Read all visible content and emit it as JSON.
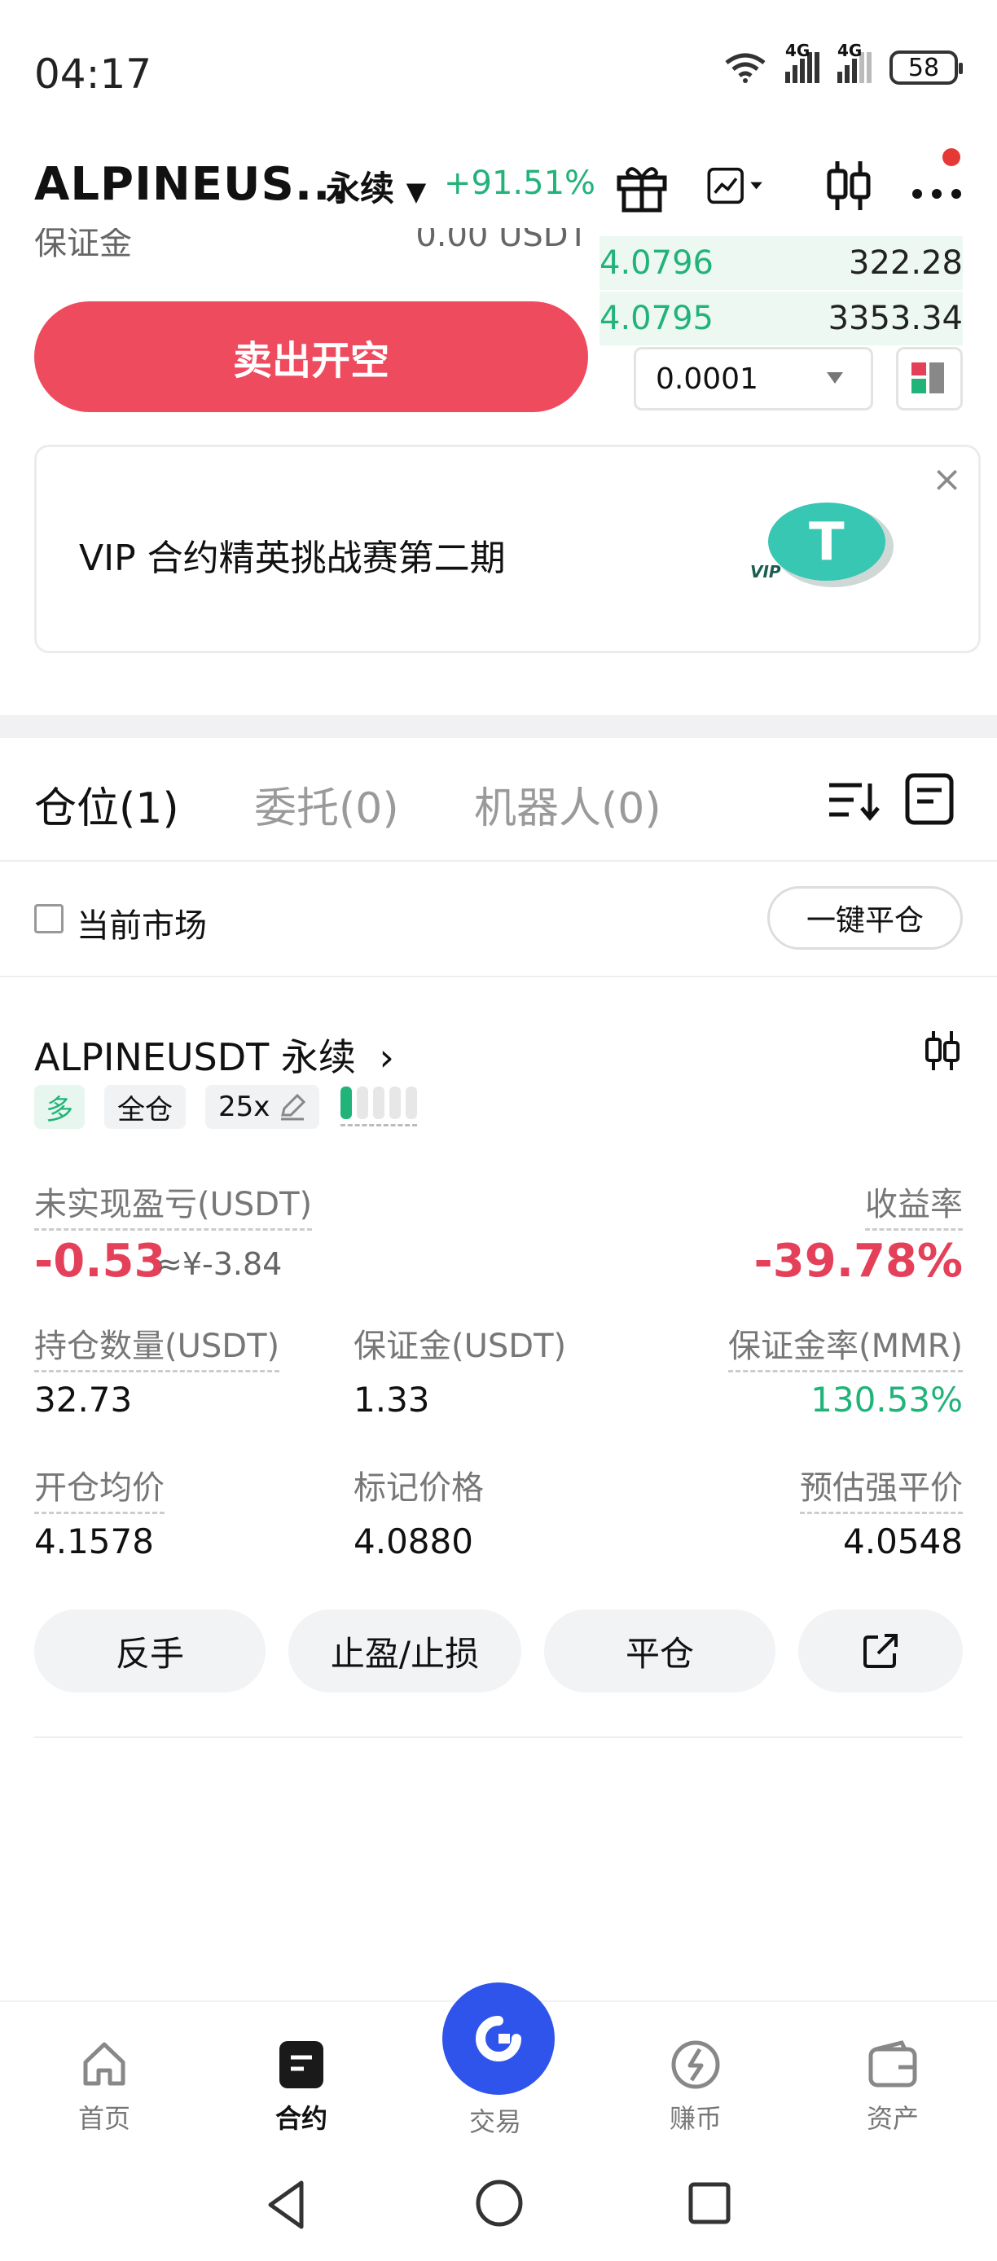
{
  "status_bar": {
    "time": "04:17",
    "network_1": "4G",
    "network_2": "4G",
    "battery": "58"
  },
  "header": {
    "pair": "ALPINEUS...",
    "contract_type": "永续",
    "change": "+91.51%"
  },
  "clipped_row": {
    "label": "保证金",
    "value": "0.00 USDT"
  },
  "order_book": [
    {
      "price": "4.0796",
      "qty": "322.28"
    },
    {
      "price": "4.0795",
      "qty": "3353.34"
    }
  ],
  "trade": {
    "sell_button": "卖出开空",
    "precision": "0.0001"
  },
  "banner": {
    "text": "VIP 合约精英挑战赛第二期",
    "close": "×"
  },
  "tabs": [
    {
      "label": "仓位(1)"
    },
    {
      "label": "委托(0)"
    },
    {
      "label": "机器人(0)"
    }
  ],
  "filter": {
    "current_market": "当前市场",
    "close_all": "一键平仓"
  },
  "position": {
    "title": "ALPINEUSDT 永续",
    "side": "多",
    "margin_mode": "全仓",
    "leverage": "25x",
    "risk_level": 0.2,
    "unrealized_pnl_label": "未实现盈亏(USDT)",
    "unrealized_pnl": "-0.53",
    "unrealized_pnl_cny": "≈¥-3.84",
    "roe_label": "收益率",
    "roe": "-39.78%",
    "size_label": "持仓数量(USDT)",
    "size": "32.73",
    "margin_label": "保证金(USDT)",
    "margin": "1.33",
    "mmr_label": "保证金率(MMR)",
    "mmr": "130.53%",
    "entry_label": "开仓均价",
    "entry": "4.1578",
    "mark_label": "标记价格",
    "mark": "4.0880",
    "liq_label": "预估强平价",
    "liq": "4.0548"
  },
  "actions": {
    "reverse": "反手",
    "tpsl": "止盈/止损",
    "close": "平仓"
  },
  "bottom_nav": [
    {
      "label": "首页",
      "icon": "home-icon"
    },
    {
      "label": "合约",
      "icon": "contract-icon"
    },
    {
      "label": "交易",
      "icon": "trade-icon"
    },
    {
      "label": "赚币",
      "icon": "earn-icon"
    },
    {
      "label": "资产",
      "icon": "wallet-icon"
    }
  ],
  "colors": {
    "green": "#22b37a",
    "red": "#e5405a",
    "sell": "#ef4b5f",
    "blue": "#2f54eb"
  }
}
